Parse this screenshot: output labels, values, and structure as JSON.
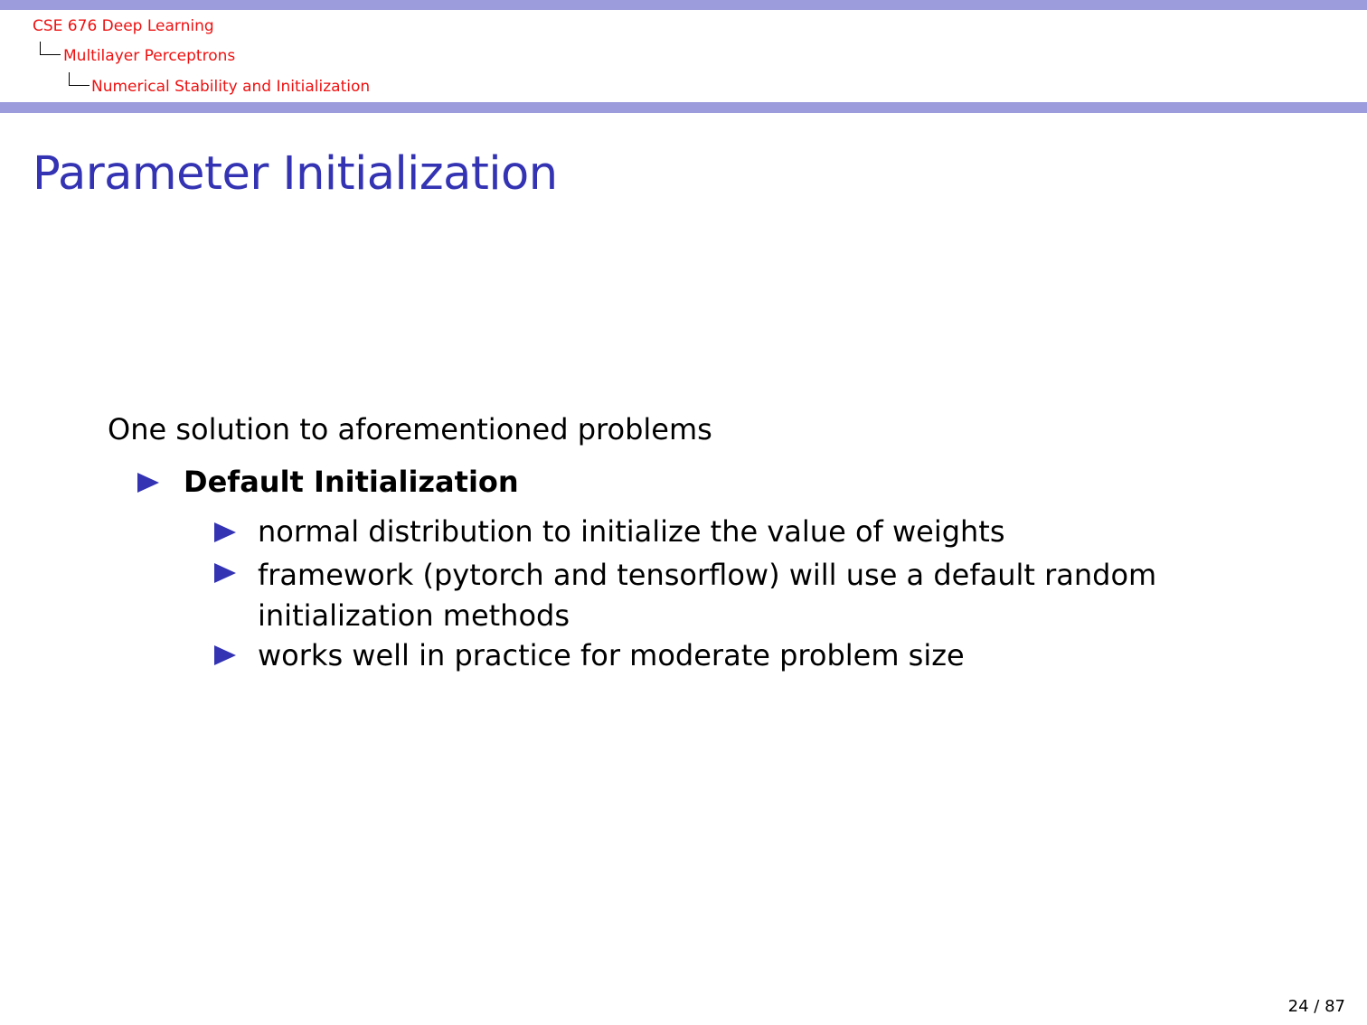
{
  "header": {
    "breadcrumb": [
      "CSE 676 Deep Learning",
      "Multilayer Perceptrons",
      "Numerical Stability and Initialization"
    ]
  },
  "slide": {
    "title": "Parameter Initialization",
    "intro": "One solution to aforementioned problems",
    "items": [
      {
        "label": "Default Initialization",
        "subitems": [
          "normal distribution to initialize the value of weights",
          "framework (pytorch and tensorflow) will use a default random initialization methods",
          "works well in practice for moderate problem size"
        ]
      }
    ]
  },
  "footer": {
    "page": "24 / 87"
  },
  "colors": {
    "header_bar": "#9c9cdc",
    "breadcrumb": "#ee1111",
    "title": "#3333b3",
    "bullet": "#3333b3"
  },
  "icons": {
    "bullet": "triangle-right-bullet-icon",
    "tree": "tree-connector-icon"
  }
}
